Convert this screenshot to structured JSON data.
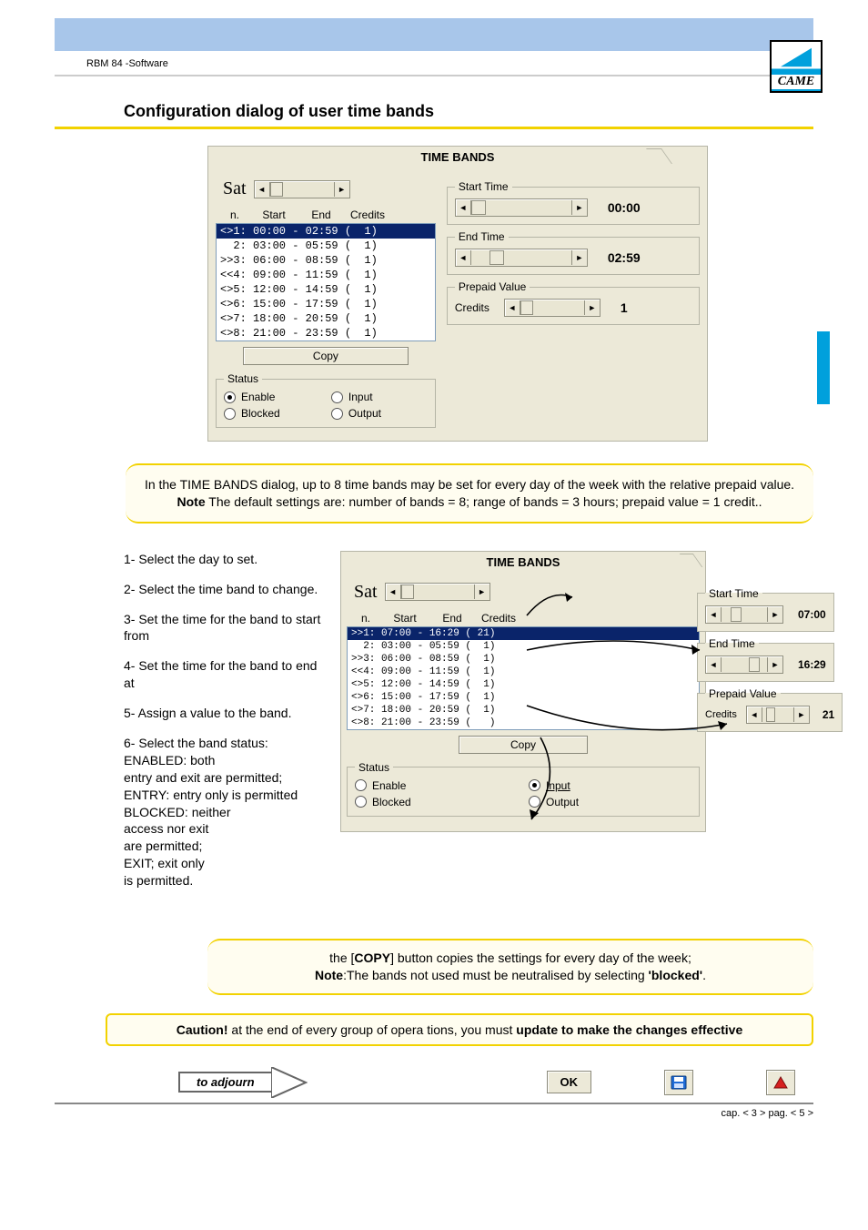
{
  "doc": {
    "product_line": "RBM 84 -Software",
    "section_title": "Configuration dialog of user time bands",
    "footer": "cap. < 3 > pag. < 5 >",
    "logo_text": "CAME"
  },
  "dialog1": {
    "title": "TIME BANDS",
    "day": "Sat",
    "headers": {
      "n": "n.",
      "start": "Start",
      "end": "End",
      "credits": "Credits"
    },
    "rows": [
      {
        "mark": "<>",
        "n": "1",
        "start": "00:00",
        "end": "02:59",
        "credits": "1",
        "sel": true
      },
      {
        "mark": "  ",
        "n": "2",
        "start": "03:00",
        "end": "05:59",
        "credits": "1",
        "sel": false
      },
      {
        "mark": ">>",
        "n": "3",
        "start": "06:00",
        "end": "08:59",
        "credits": "1",
        "sel": false
      },
      {
        "mark": "<<",
        "n": "4",
        "start": "09:00",
        "end": "11:59",
        "credits": "1",
        "sel": false
      },
      {
        "mark": "<>",
        "n": "5",
        "start": "12:00",
        "end": "14:59",
        "credits": "1",
        "sel": false
      },
      {
        "mark": "<>",
        "n": "6",
        "start": "15:00",
        "end": "17:59",
        "credits": "1",
        "sel": false
      },
      {
        "mark": "<>",
        "n": "7",
        "start": "18:00",
        "end": "20:59",
        "credits": "1",
        "sel": false
      },
      {
        "mark": "<>",
        "n": "8",
        "start": "21:00",
        "end": "23:59",
        "credits": "1",
        "sel": false
      }
    ],
    "copy": "Copy",
    "status_legend": "Status",
    "status": {
      "enable": "Enable",
      "input": "Input",
      "blocked": "Blocked",
      "output": "Output",
      "selected": "enable"
    },
    "right": {
      "start_legend": "Start Time",
      "start_value": "00:00",
      "end_legend": "End Time",
      "end_value": "02:59",
      "prepaid_legend": "Prepaid Value",
      "credits_label": "Credits",
      "credits_value": "1"
    }
  },
  "note1": {
    "line1": "In the TIME BANDS dialog, up to 8 time bands may be set for every day of the week with the relative prepaid value.",
    "line2_prefix": "Note",
    "line2": " The default settings are: number of bands = 8; range of bands = 3 hours; prepaid value = 1 credit.."
  },
  "instructions": {
    "s1": "1- Select the day to set.",
    "s2": "2- Select the time band to change.",
    "s3": "3- Set the time for the band to start from",
    "s4": "4- Set the time for the band to end at",
    "s5": "5- Assign a value to the band.",
    "s6a": "6- Select the band status:",
    "s6b": "ENABLED: both",
    "s6c": "entry and exit are permitted;",
    "s6d": "ENTRY: entry only is permitted",
    "s6e": "BLOCKED: neither",
    "s6f": "access nor exit",
    "s6g": "are permitted;",
    "s6h": "EXIT; exit only",
    "s6i": "is permitted."
  },
  "dialog2": {
    "title": "TIME BANDS",
    "day": "Sat",
    "headers": {
      "n": "n.",
      "start": "Start",
      "end": "End",
      "credits": "Credits"
    },
    "rows": [
      {
        "mark": ">>",
        "n": "1",
        "start": "07:00",
        "end": "16:29",
        "credits": "21",
        "sel": true
      },
      {
        "mark": "  ",
        "n": "2",
        "start": "03:00",
        "end": "05:59",
        "credits": "1",
        "sel": false
      },
      {
        "mark": ">>",
        "n": "3",
        "start": "06:00",
        "end": "08:59",
        "credits": "1",
        "sel": false
      },
      {
        "mark": "<<",
        "n": "4",
        "start": "09:00",
        "end": "11:59",
        "credits": "1",
        "sel": false
      },
      {
        "mark": "<>",
        "n": "5",
        "start": "12:00",
        "end": "14:59",
        "credits": "1",
        "sel": false
      },
      {
        "mark": "<>",
        "n": "6",
        "start": "15:00",
        "end": "17:59",
        "credits": "1",
        "sel": false
      },
      {
        "mark": "<>",
        "n": "7",
        "start": "18:00",
        "end": "20:59",
        "credits": "1",
        "sel": false
      },
      {
        "mark": "<>",
        "n": "8",
        "start": "21:00",
        "end": "23:59",
        "credits": "",
        "sel": false
      }
    ],
    "copy": "Copy",
    "status_legend": "Status",
    "status": {
      "enable": "Enable",
      "input": "Input",
      "blocked": "Blocked",
      "output": "Output",
      "selected": "input"
    },
    "right": {
      "start_legend": "Start Time",
      "start_value": "07:00",
      "end_legend": "End Time",
      "end_value": "16:29",
      "prepaid_legend": "Prepaid Value",
      "credits_label": "Credits",
      "credits_value": "21"
    }
  },
  "note2": {
    "line1a": "the [",
    "line1b": "COPY",
    "line1c": "] button copies the settings for every day of the week;",
    "line2_prefix": "Note",
    "line2": ":The bands not used must be neutralised by selecting ",
    "line2_bold": "'blocked'",
    "line2_end": "."
  },
  "caution": {
    "prefix": "Caution!",
    "mid": " at the end of every group of opera tions, you must ",
    "bold": "update to make the changes effective"
  },
  "adjourn": {
    "label": "to adjourn",
    "ok": "OK"
  }
}
